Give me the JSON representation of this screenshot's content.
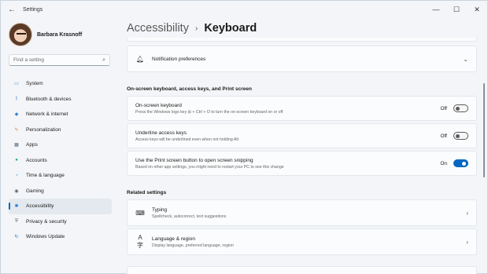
{
  "window": {
    "title": "Settings",
    "back_icon": "back-arrow-icon",
    "controls": [
      "minimize-icon",
      "maximize-icon",
      "close-icon"
    ]
  },
  "profile": {
    "name": "Barbara Krasnoff"
  },
  "search": {
    "placeholder": "Find a setting"
  },
  "nav": {
    "items": [
      {
        "label": "System",
        "icon": "system-icon",
        "color": "#2f76c7",
        "active": false
      },
      {
        "label": "Bluetooth & devices",
        "icon": "bluetooth-icon",
        "color": "#1c73d0",
        "active": false
      },
      {
        "label": "Network & internet",
        "icon": "network-icon",
        "color": "#3a7fd0",
        "active": false
      },
      {
        "label": "Personalization",
        "icon": "personalization-icon",
        "color": "#d9823b",
        "active": false
      },
      {
        "label": "Apps",
        "icon": "apps-icon",
        "color": "#50627a",
        "active": false
      },
      {
        "label": "Accounts",
        "icon": "accounts-icon",
        "color": "#2aa36b",
        "active": false
      },
      {
        "label": "Time & language",
        "icon": "time-language-icon",
        "color": "#3b86d6",
        "active": false
      },
      {
        "label": "Gaming",
        "icon": "gaming-icon",
        "color": "#5a6270",
        "active": false
      },
      {
        "label": "Accessibility",
        "icon": "accessibility-icon",
        "color": "#1976d2",
        "active": true
      },
      {
        "label": "Privacy & security",
        "icon": "privacy-icon",
        "color": "#6b7480",
        "active": false
      },
      {
        "label": "Windows Update",
        "icon": "windows-update-icon",
        "color": "#1d7bd6",
        "active": false
      }
    ]
  },
  "breadcrumb": {
    "parent": "Accessibility",
    "separator": "›",
    "current": "Keyboard"
  },
  "notification": {
    "label": "Notification preferences",
    "icon": "bell-icon"
  },
  "keyboard_section": {
    "heading": "On-screen keyboard, access keys, and Print screen",
    "rows": [
      {
        "title": "On-screen keyboard",
        "desc": "Press the Windows logo key ⊞ + Ctrl + O to turn the on-screen keyboard on or off",
        "state": "Off",
        "on": false
      },
      {
        "title": "Underline access keys",
        "desc": "Access keys will be underlined even when not holding Alt",
        "state": "Off",
        "on": false
      },
      {
        "title": "Use the Print screen button to open screen snipping",
        "desc": "Based on other app settings, you might need to restart your PC to see this change",
        "state": "On",
        "on": true
      }
    ]
  },
  "related": {
    "heading": "Related settings",
    "rows": [
      {
        "title": "Typing",
        "desc": "Spellcheck, autocorrect, text suggestions",
        "icon": "keyboard-icon"
      },
      {
        "title": "Language & region",
        "desc": "Display language, preferred language, region",
        "icon": "language-icon"
      }
    ]
  },
  "accent_color": "#0067c0"
}
